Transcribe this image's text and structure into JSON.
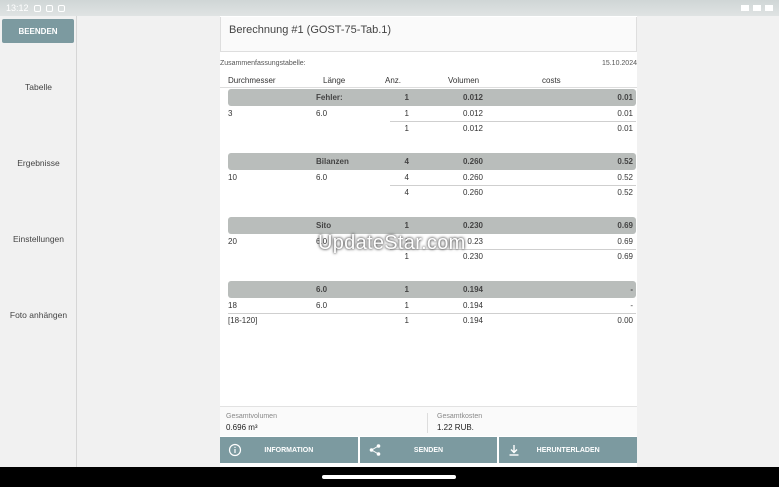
{
  "status_bar": {
    "time": "13:12"
  },
  "sidebar": {
    "end_button": "BEENDEN",
    "items": [
      "Tabelle",
      "Ergebnisse",
      "Einstellungen",
      "Foto anhängen"
    ]
  },
  "header": {
    "title": "Berechnung #1 (GOST-75-Tab.1)"
  },
  "summary": {
    "label": "Zusammenfassungstabelle:",
    "date": "15.10.2024"
  },
  "table": {
    "columns": [
      "Durchmesser",
      "Länge",
      "Anz.",
      "Volumen",
      "costs"
    ],
    "groups": [
      {
        "head": {
          "dm": "",
          "len": "Fehler:",
          "cnt": "1",
          "vol": "0.012",
          "cost": "0.01"
        },
        "rows": [
          {
            "dm": "3",
            "len": "6.0",
            "cnt": "1",
            "vol": "0.012",
            "cost": "0.01"
          },
          {
            "dm": "",
            "len": "",
            "cnt": "1",
            "vol": "0.012",
            "cost": "0.01"
          }
        ]
      },
      {
        "head": {
          "dm": "",
          "len": "Bilanzen",
          "cnt": "4",
          "vol": "0.260",
          "cost": "0.52"
        },
        "rows": [
          {
            "dm": "10",
            "len": "6.0",
            "cnt": "4",
            "vol": "0.260",
            "cost": "0.52"
          },
          {
            "dm": "",
            "len": "",
            "cnt": "4",
            "vol": "0.260",
            "cost": "0.52"
          }
        ]
      },
      {
        "head": {
          "dm": "",
          "len": "Sito",
          "cnt": "1",
          "vol": "0.230",
          "cost": "0.69"
        },
        "rows": [
          {
            "dm": "20",
            "len": "6.0",
            "cnt": "1",
            "vol": "0.23",
            "cost": "0.69"
          },
          {
            "dm": "",
            "len": "",
            "cnt": "1",
            "vol": "0.230",
            "cost": "0.69"
          }
        ]
      },
      {
        "head": {
          "dm": "",
          "len": "6.0",
          "cnt": "1",
          "vol": "0.194",
          "cost": "-"
        },
        "rows": [
          {
            "dm": "18",
            "len": "6.0",
            "cnt": "1",
            "vol": "0.194",
            "cost": "-"
          },
          {
            "dm": "[18-120]",
            "len": "",
            "cnt": "1",
            "vol": "0.194",
            "cost": "0.00"
          }
        ]
      }
    ]
  },
  "totals": {
    "volume_label": "Gesamtvolumen",
    "volume_value": "0.696 m³",
    "cost_label": "Gesamtkosten",
    "cost_value": "1.22 RUB."
  },
  "actions": {
    "info": "INFORMATION",
    "send": "SENDEN",
    "download": "HERUNTERLADEN"
  },
  "watermark": "UpdateStar.com",
  "icons": [
    "info-icon",
    "share-icon",
    "download-icon"
  ],
  "colors": {
    "accent": "#7c9aa0",
    "group_head": "#b9bdbb"
  }
}
